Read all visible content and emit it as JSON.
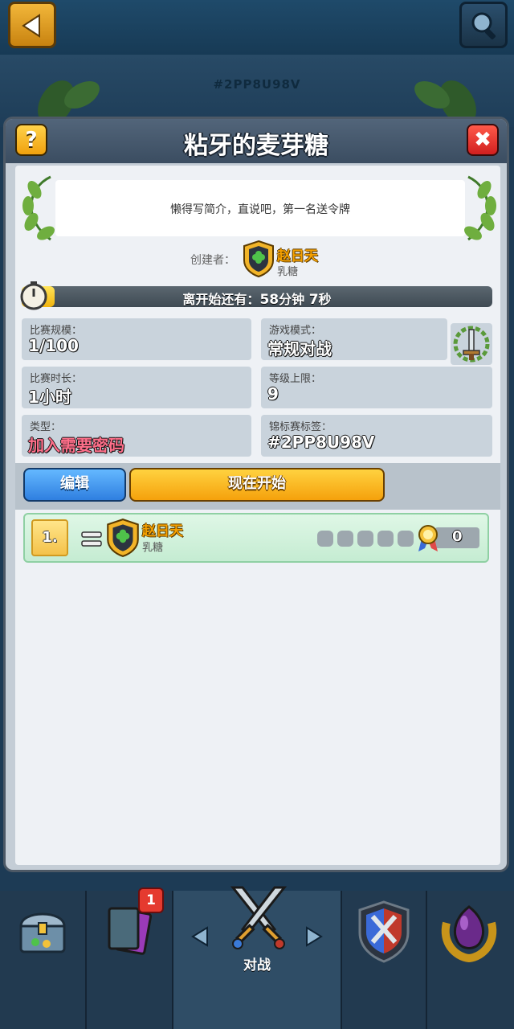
{
  "background_tag": "#2PP8U98V",
  "panel": {
    "title": "粘牙的麦芽糖",
    "help_label": "?",
    "close_label": "✖",
    "description": "懒得写简介，直说吧，第一名送令牌",
    "creator_label": "创建者：",
    "creator_name": "赵日天",
    "creator_clan": "乳糖",
    "timer_prefix": "离开始还有：",
    "timer_minutes": "58",
    "timer_min_unit": "分钟",
    "timer_seconds": "7",
    "timer_sec_unit": "秒",
    "timer_progress": 0.07
  },
  "stats": {
    "size_label": "比赛规模：",
    "size_value": "1/100",
    "mode_label": "游戏模式：",
    "mode_value": "常规对战",
    "duration_label": "比赛时长：",
    "duration_value": "1小时",
    "level_label": "等级上限：",
    "level_value": "9",
    "type_label": "类型：",
    "type_value": "加入需要密码",
    "tag_label": "锦标赛标签：",
    "tag_value": "#2PP8U98V"
  },
  "buttons": {
    "edit": "编辑",
    "start": "现在开始"
  },
  "leaderboard": [
    {
      "rank": "1.",
      "name": "赵日天",
      "clan": "乳糖",
      "score": "0"
    }
  ],
  "nav": {
    "battle_label": "对战",
    "cards_badge": "1"
  },
  "colors": {
    "gold_name": "#f5a000",
    "password_red": "#ff6f8a",
    "edit_blue": "#2f7fe0",
    "start_yellow": "#f5a10c"
  }
}
